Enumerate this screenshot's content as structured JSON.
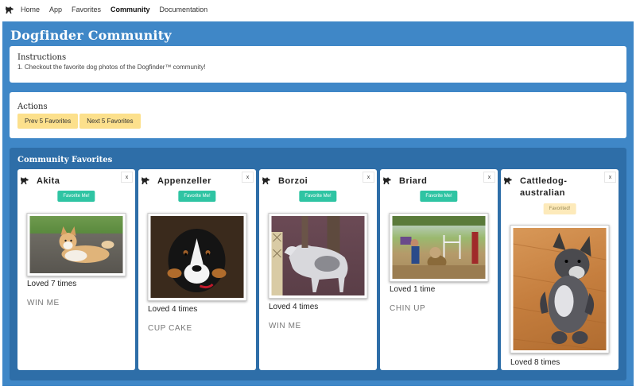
{
  "nav": {
    "brand_icon": "dog-icon",
    "links": [
      "Home",
      "App",
      "Favorites",
      "Community",
      "Documentation"
    ],
    "active": "Community"
  },
  "page": {
    "title": "Dogfinder Community"
  },
  "instructions": {
    "heading": "Instructions",
    "text": "1. Checkout the favorite dog photos of the Dogfinder™ community!"
  },
  "actions": {
    "heading": "Actions",
    "prev_label": "Prev 5 Favorites",
    "next_label": "Next 5 Favorites"
  },
  "favorites": {
    "heading": "Community Favorites",
    "cards": [
      {
        "breed": "Akita",
        "button": "Favorite Me!",
        "favorited": false,
        "loved": "Loved 7 times",
        "nickname": "WIN ME"
      },
      {
        "breed": "Appenzeller",
        "button": "Favorite Me!",
        "favorited": false,
        "loved": "Loved 4 times",
        "nickname": "CUP CAKE"
      },
      {
        "breed": "Borzoi",
        "button": "Favorite Me!",
        "favorited": false,
        "loved": "Loved 4 times",
        "nickname": "WIN ME"
      },
      {
        "breed": "Briard",
        "button": "Favorite Me!",
        "favorited": false,
        "loved": "Loved 1 time",
        "nickname": "CHIN UP"
      },
      {
        "breed": "Cattledog-australian",
        "button": "Favorited!",
        "favorited": true,
        "loved": "Loved 8 times",
        "nickname": ""
      }
    ],
    "close_label": "x"
  },
  "colors": {
    "main_bg": "#3f87c7",
    "favorites_bg": "#2e6ea8",
    "action_button": "#fce08c",
    "favorite_button": "#2fc4a3",
    "favorited_button": "#fdeaba"
  }
}
